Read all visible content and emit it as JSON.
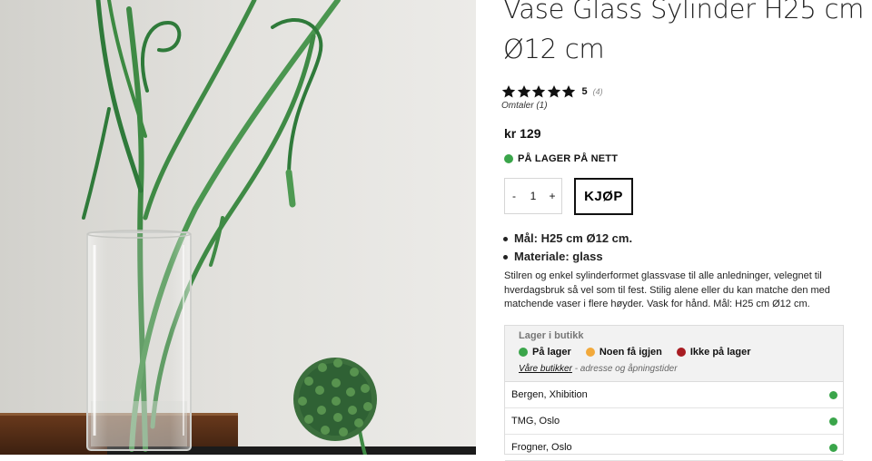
{
  "product": {
    "title": "Vase Glass Sylinder H25 cm Ø12 cm",
    "rating": {
      "stars": 5,
      "score": "5",
      "count": "(4)"
    },
    "reviews_link": "Omtaler (1)",
    "price": "kr 129",
    "online_stock": "PÅ LAGER PÅ NETT",
    "quantity": {
      "minus": "-",
      "value": "1",
      "plus": "+"
    },
    "buy_label": "KJØP",
    "specs": [
      "Mål: H25 cm Ø12 cm.",
      "Materiale: glass"
    ],
    "description": "Stilren og enkel sylinderformet glassvase til alle anledninger, velegnet til hverdagsbruk så vel som til fest. Stilig alene eller du kan matche den med matchende vaser i flere høyder. Vask for hånd. Mål: H25 cm Ø12 cm."
  },
  "store_stock": {
    "title": "Lager i butikk",
    "legend": [
      {
        "label": "På lager",
        "color": "#3aa54a"
      },
      {
        "label": "Noen få igjen",
        "color": "#f2a93b"
      },
      {
        "label": "Ikke på lager",
        "color": "#a81c22"
      }
    ],
    "stores_link": "Våre butikker",
    "stores_suffix": "- adresse og åpningstider",
    "stores": [
      {
        "name": "Bergen, Xhibition",
        "status": "in-stock"
      },
      {
        "name": "TMG, Oslo",
        "status": "in-stock"
      },
      {
        "name": "Frogner, Oslo",
        "status": "in-stock"
      }
    ]
  }
}
